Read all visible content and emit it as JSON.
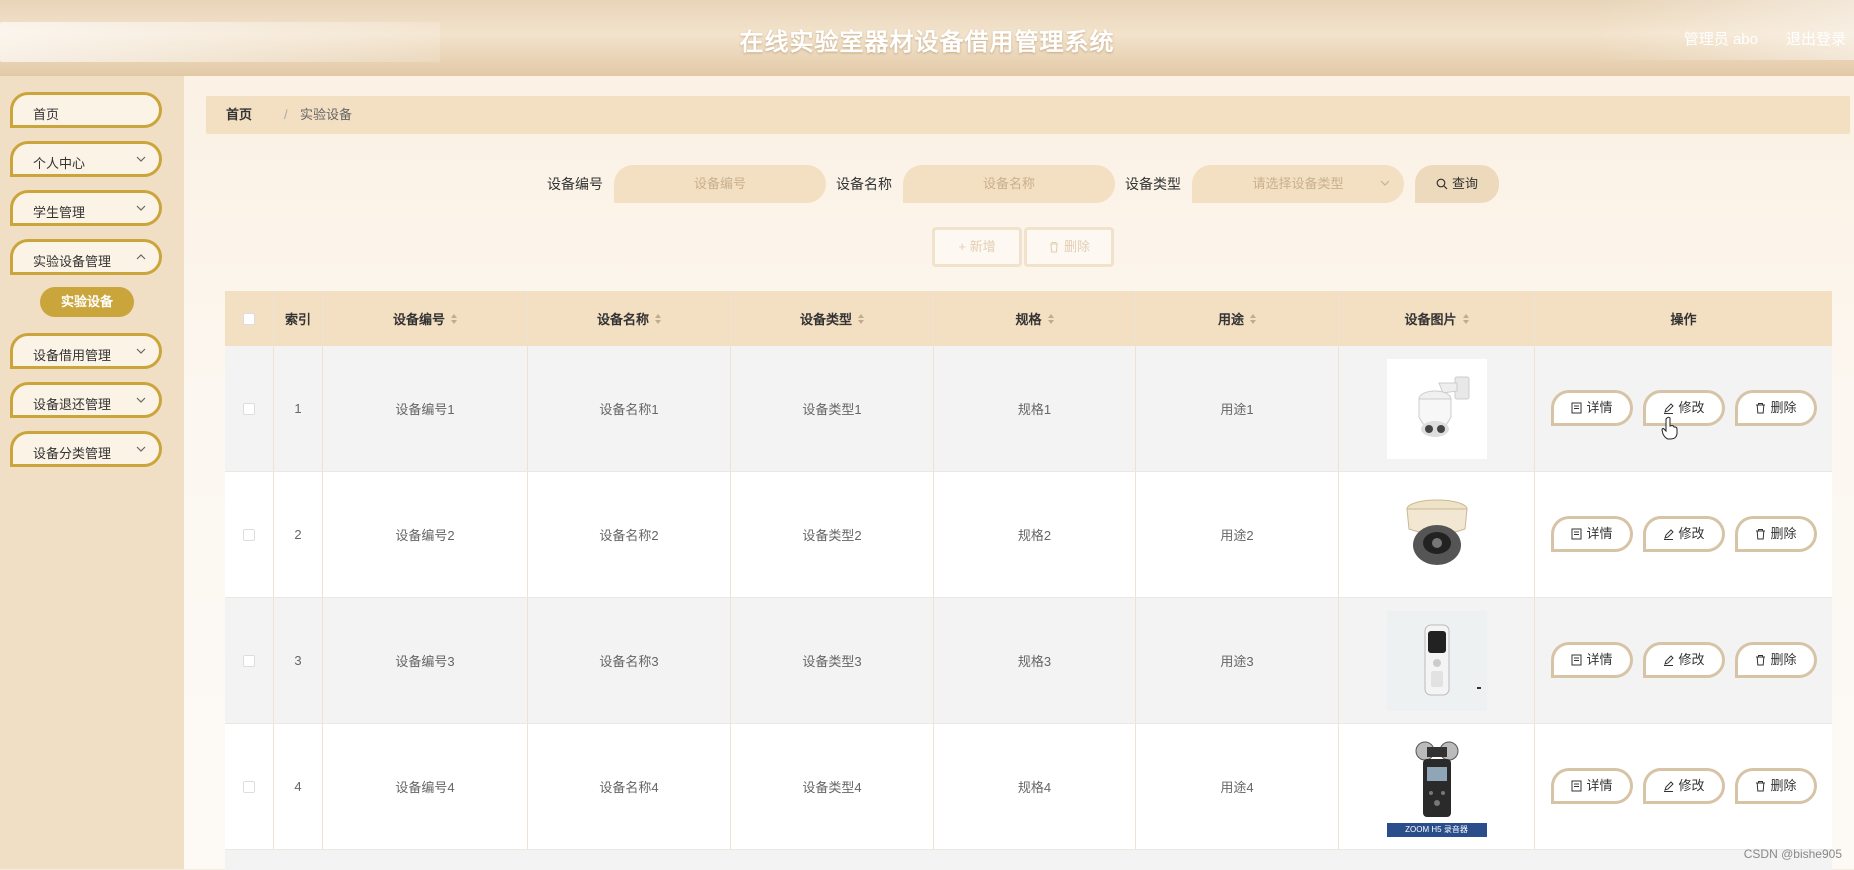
{
  "header": {
    "title": "在线实验室器材设备借用管理系统",
    "admin_label": "管理员 abo",
    "logout_label": "退出登录"
  },
  "sidebar": {
    "items": [
      {
        "label": "首页",
        "has_children": false
      },
      {
        "label": "个人中心",
        "has_children": true
      },
      {
        "label": "学生管理",
        "has_children": true
      },
      {
        "label": "实验设备管理",
        "has_children": true
      },
      {
        "label": "设备借用管理",
        "has_children": true
      },
      {
        "label": "设备退还管理",
        "has_children": true
      },
      {
        "label": "设备分类管理",
        "has_children": true
      }
    ],
    "active_sub_item": "实验设备"
  },
  "breadcrumb": {
    "home": "首页",
    "separator": "/",
    "current": "实验设备"
  },
  "search": {
    "code_label": "设备编号",
    "code_placeholder": "设备编号",
    "name_label": "设备名称",
    "name_placeholder": "设备名称",
    "type_label": "设备类型",
    "type_placeholder": "请选择设备类型",
    "query_label": "查询"
  },
  "actions": {
    "add_label": "+ 新增",
    "delete_label": "删除"
  },
  "table": {
    "headers": {
      "index": "索引",
      "code": "设备编号",
      "name": "设备名称",
      "type": "设备类型",
      "spec": "规格",
      "usage": "用途",
      "image": "设备图片",
      "ops": "操作"
    },
    "rows": [
      {
        "index": "1",
        "code": "设备编号1",
        "name": "设备名称1",
        "type": "设备类型1",
        "spec": "规格1",
        "usage": "用途1",
        "image_icon": "dome-ptz-camera"
      },
      {
        "index": "2",
        "code": "设备编号2",
        "name": "设备名称2",
        "type": "设备类型2",
        "spec": "规格2",
        "usage": "用途2",
        "image_icon": "dome-camera"
      },
      {
        "index": "3",
        "code": "设备编号3",
        "name": "设备名称3",
        "type": "设备类型3",
        "spec": "规格3",
        "usage": "用途3",
        "image_icon": "voice-recorder"
      },
      {
        "index": "4",
        "code": "设备编号4",
        "name": "设备名称4",
        "type": "设备类型4",
        "spec": "规格4",
        "usage": "用途4",
        "image_icon": "zoom-h5-recorder",
        "image_caption": "ZOOM H5 录音器"
      }
    ],
    "op_labels": {
      "detail": "详情",
      "edit": "修改",
      "delete": "删除"
    }
  },
  "watermark": "CSDN @bishe905",
  "colors": {
    "accent": "#c9a53c",
    "header_bg": "#f3dfc2",
    "sidebar_bg": "#f0dfc5"
  }
}
